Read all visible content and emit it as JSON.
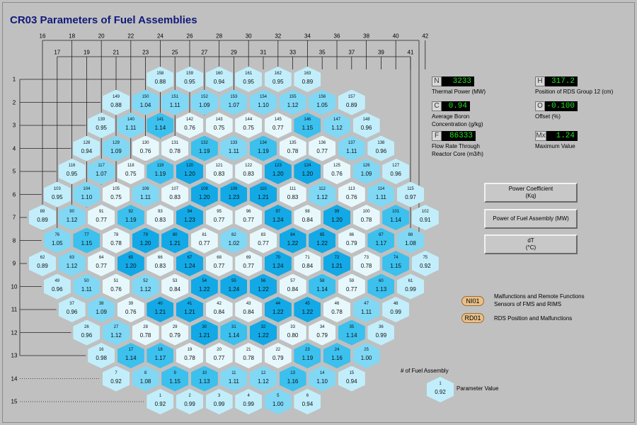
{
  "title": "CR03 Parameters of Fuel Assemblies",
  "top_axis_even": [
    "16",
    "18",
    "20",
    "22",
    "24",
    "26",
    "28",
    "30",
    "32",
    "34",
    "36",
    "38",
    "40",
    "42"
  ],
  "top_axis_odd": [
    "17",
    "19",
    "21",
    "23",
    "25",
    "27",
    "29",
    "31",
    "33",
    "35",
    "37",
    "39",
    "41"
  ],
  "row_labels": [
    "1",
    "2",
    "3",
    "4",
    "5",
    "6",
    "7",
    "8",
    "9",
    "10",
    "11",
    "12",
    "13",
    "14",
    "15"
  ],
  "rows": [
    [
      [
        158,
        "0.88"
      ],
      [
        159,
        "0.95"
      ],
      [
        160,
        "0.94"
      ],
      [
        161,
        "0.95"
      ],
      [
        162,
        "0.95"
      ],
      [
        163,
        "0.89"
      ]
    ],
    [
      [
        149,
        "0.88"
      ],
      [
        150,
        "1.04"
      ],
      [
        151,
        "1.11"
      ],
      [
        152,
        "1.09"
      ],
      [
        153,
        "1.07"
      ],
      [
        154,
        "1.10"
      ],
      [
        155,
        "1.12"
      ],
      [
        156,
        "1.05"
      ],
      [
        157,
        "0.89"
      ]
    ],
    [
      [
        139,
        "0.95"
      ],
      [
        140,
        "1.11"
      ],
      [
        141,
        "1.14"
      ],
      [
        142,
        "0.76"
      ],
      [
        143,
        "0.75"
      ],
      [
        144,
        "0.75"
      ],
      [
        145,
        "0.77"
      ],
      [
        146,
        "1.15"
      ],
      [
        147,
        "1.12"
      ],
      [
        148,
        "0.96"
      ]
    ],
    [
      [
        128,
        "0.94"
      ],
      [
        129,
        "1.09"
      ],
      [
        130,
        "0.76"
      ],
      [
        131,
        "0.78"
      ],
      [
        132,
        "1.19"
      ],
      [
        133,
        "1.11"
      ],
      [
        134,
        "1.19"
      ],
      [
        135,
        "0.78"
      ],
      [
        136,
        "0.77"
      ],
      [
        137,
        "1.11"
      ],
      [
        138,
        "0.96"
      ]
    ],
    [
      [
        116,
        "0.95"
      ],
      [
        117,
        "1.07"
      ],
      [
        118,
        "0.75"
      ],
      [
        119,
        "1.19"
      ],
      [
        120,
        "1.20"
      ],
      [
        121,
        "0.83"
      ],
      [
        122,
        "0.83"
      ],
      [
        123,
        "1.20"
      ],
      [
        124,
        "1.20"
      ],
      [
        125,
        "0.76"
      ],
      [
        126,
        "1.09"
      ],
      [
        127,
        "0.96"
      ]
    ],
    [
      [
        103,
        "0.95"
      ],
      [
        104,
        "1.10"
      ],
      [
        105,
        "0.75"
      ],
      [
        106,
        "1.11"
      ],
      [
        107,
        "0.83"
      ],
      [
        108,
        "1.20"
      ],
      [
        109,
        "1.23"
      ],
      [
        110,
        "1.21"
      ],
      [
        111,
        "0.83"
      ],
      [
        112,
        "1.12"
      ],
      [
        113,
        "0.76"
      ],
      [
        114,
        "1.11"
      ],
      [
        115,
        "0.97"
      ]
    ],
    [
      [
        89,
        "0.89"
      ],
      [
        90,
        "1.12"
      ],
      [
        91,
        "0.77"
      ],
      [
        92,
        "1.19"
      ],
      [
        93,
        "0.83"
      ],
      [
        94,
        "1.23"
      ],
      [
        95,
        "0.77"
      ],
      [
        96,
        "0.77"
      ],
      [
        97,
        "1.24"
      ],
      [
        98,
        "0.84"
      ],
      [
        99,
        "1.20"
      ],
      [
        100,
        "0.78"
      ],
      [
        101,
        "1.14"
      ],
      [
        102,
        "0.91"
      ]
    ],
    [
      [
        76,
        "1.05"
      ],
      [
        77,
        "1.15"
      ],
      [
        78,
        "0.78"
      ],
      [
        79,
        "1.20"
      ],
      [
        80,
        "1.21"
      ],
      [
        81,
        "0.77"
      ],
      [
        82,
        "1.02"
      ],
      [
        83,
        "0.77"
      ],
      [
        84,
        "1.22"
      ],
      [
        85,
        "1.22"
      ],
      [
        86,
        "0.79"
      ],
      [
        87,
        "1.17"
      ],
      [
        88,
        "1.08"
      ]
    ],
    [
      [
        62,
        "0.89"
      ],
      [
        63,
        "1.12"
      ],
      [
        64,
        "0.77"
      ],
      [
        65,
        "1.20"
      ],
      [
        66,
        "0.83"
      ],
      [
        67,
        "1.24"
      ],
      [
        68,
        "0.77"
      ],
      [
        69,
        "0.77"
      ],
      [
        70,
        "1.24"
      ],
      [
        71,
        "0.84"
      ],
      [
        72,
        "1.21"
      ],
      [
        73,
        "0.78"
      ],
      [
        74,
        "1.15"
      ],
      [
        75,
        "0.92"
      ]
    ],
    [
      [
        49,
        "0.96"
      ],
      [
        50,
        "1.11"
      ],
      [
        51,
        "0.76"
      ],
      [
        52,
        "1.12"
      ],
      [
        53,
        "0.84"
      ],
      [
        54,
        "1.22"
      ],
      [
        55,
        "1.24"
      ],
      [
        56,
        "1.22"
      ],
      [
        57,
        "0.84"
      ],
      [
        58,
        "1.14"
      ],
      [
        59,
        "0.77"
      ],
      [
        60,
        "1.13"
      ],
      [
        61,
        "0.99"
      ]
    ],
    [
      [
        37,
        "0.96"
      ],
      [
        38,
        "1.09"
      ],
      [
        39,
        "0.76"
      ],
      [
        40,
        "1.21"
      ],
      [
        41,
        "1.21"
      ],
      [
        42,
        "0.84"
      ],
      [
        43,
        "0.84"
      ],
      [
        44,
        "1.22"
      ],
      [
        45,
        "1.22"
      ],
      [
        46,
        "0.78"
      ],
      [
        47,
        "1.11"
      ],
      [
        48,
        "0.99"
      ]
    ],
    [
      [
        26,
        "0.96"
      ],
      [
        27,
        "1.12"
      ],
      [
        28,
        "0.78"
      ],
      [
        29,
        "0.79"
      ],
      [
        30,
        "1.21"
      ],
      [
        31,
        "1.14"
      ],
      [
        32,
        "1.22"
      ],
      [
        33,
        "0.80"
      ],
      [
        34,
        "0.79"
      ],
      [
        35,
        "1.14"
      ],
      [
        36,
        "0.99"
      ]
    ],
    [
      [
        16,
        "0.98"
      ],
      [
        17,
        "1.14"
      ],
      [
        18,
        "1.17"
      ],
      [
        19,
        "0.78"
      ],
      [
        20,
        "0.77"
      ],
      [
        21,
        "0.78"
      ],
      [
        22,
        "0.79"
      ],
      [
        23,
        "1.19"
      ],
      [
        24,
        "1.16"
      ],
      [
        25,
        "1.00"
      ]
    ],
    [
      [
        7,
        "0.92"
      ],
      [
        8,
        "1.08"
      ],
      [
        9,
        "1.15"
      ],
      [
        10,
        "1.13"
      ],
      [
        11,
        "1.11"
      ],
      [
        12,
        "1.12"
      ],
      [
        13,
        "1.16"
      ],
      [
        14,
        "1.10"
      ],
      [
        15,
        "0.94"
      ]
    ],
    [
      [
        1,
        "0.92"
      ],
      [
        2,
        "0.99"
      ],
      [
        3,
        "0.99"
      ],
      [
        4,
        "0.99"
      ],
      [
        5,
        "1.00"
      ],
      [
        6,
        "0.94"
      ]
    ]
  ],
  "indicators": {
    "n": {
      "tag": "N",
      "value": "3233",
      "caption": "Thermal Power (MW)"
    },
    "h": {
      "tag": "H",
      "value": "317.2",
      "caption": "Position of RDS Group 12 (cm)"
    },
    "c": {
      "tag": "C",
      "value": "0.94",
      "caption1": "Average Boron",
      "caption2": "Concentration (g/kg)"
    },
    "o": {
      "tag": "O",
      "value": "-0.100",
      "caption": "Offset (%)"
    },
    "f": {
      "tag": "F",
      "value": "86333",
      "caption1": "Flow Rate Through",
      "caption2": "Reactor Core (m3/h)"
    },
    "mx": {
      "tag": "Mx",
      "value": "1.24",
      "caption": "Maximum Value"
    }
  },
  "buttons": {
    "power_coef_1": "Power Coefficient",
    "power_coef_2": "(Kq)",
    "power_fa": "Power of Fuel Assembly (MW)",
    "dt_1": "dT",
    "dt_2": "(°C)"
  },
  "links": {
    "ni01": {
      "label": "NI01",
      "caption1": "Malfunctions and Remote Functions",
      "caption2": "Sensors of FMS and RIMS"
    },
    "rd01": {
      "label": "RD01",
      "caption": "RDS Position and Malfunctions"
    }
  },
  "legend": {
    "title": "# of Fuel Assembly",
    "sample_num": "1",
    "sample_val": "0.92",
    "param_label": "Parameter Value"
  },
  "colors": {
    "lowest": "#e7f8fd",
    "low": "#c2eefb",
    "mid": "#80d8f5",
    "high": "#3cc0ee",
    "highest": "#12a9e6",
    "indicator_text": "#22e222",
    "title": "#101a7a"
  }
}
